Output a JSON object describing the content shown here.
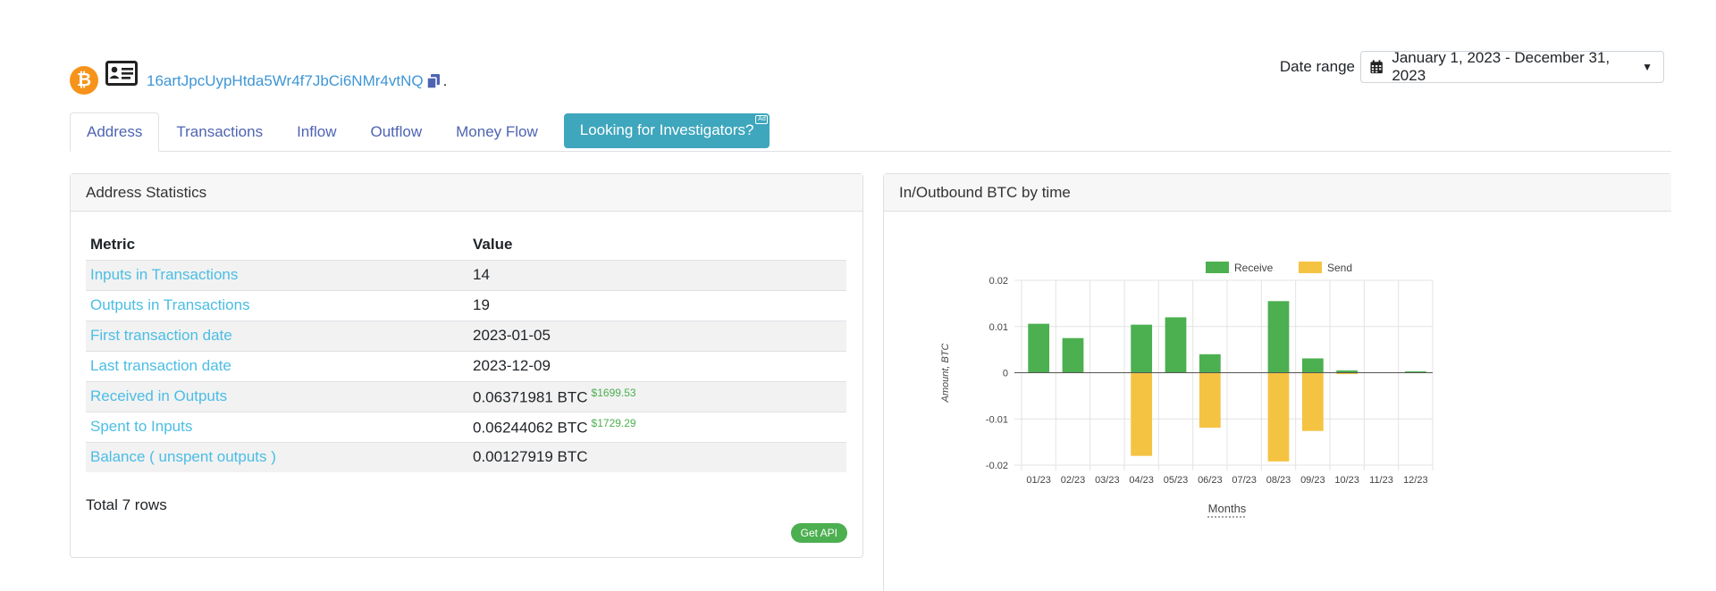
{
  "header": {
    "address": "16artJpcUypHtda5Wr4f7JbCi6NMr4vtNQ",
    "trailing": ".",
    "icons": {
      "coin": "bitcoin-icon",
      "profile": "id-card-icon",
      "copy": "copy-icon"
    },
    "date_range_label": "Date range",
    "date_range_value": "January 1, 2023 - December 31, 2023"
  },
  "tabs": [
    {
      "label": "Address",
      "active": true
    },
    {
      "label": "Transactions"
    },
    {
      "label": "Inflow"
    },
    {
      "label": "Outflow"
    },
    {
      "label": "Money Flow"
    }
  ],
  "investigators_button": {
    "label": "Looking for Investigators?",
    "badge": "Ad"
  },
  "stats": {
    "title": "Address Statistics",
    "columns": [
      "Metric",
      "Value"
    ],
    "rows": [
      {
        "metric": "Inputs in Transactions",
        "value": "14",
        "usd": ""
      },
      {
        "metric": "Outputs in Transactions",
        "value": "19",
        "usd": ""
      },
      {
        "metric": "First transaction date",
        "value": "2023-01-05",
        "usd": ""
      },
      {
        "metric": "Last transaction date",
        "value": "2023-12-09",
        "usd": ""
      },
      {
        "metric": "Received in Outputs",
        "value": "0.06371981 BTC",
        "usd": "$1699.53"
      },
      {
        "metric": "Spent to Inputs",
        "value": "0.06244062 BTC",
        "usd": "$1729.29"
      },
      {
        "metric": "Balance ( unspent outputs )",
        "value": "0.00127919 BTC",
        "usd": ""
      }
    ],
    "total": "Total 7 rows",
    "api_button": "Get API"
  },
  "chart_panel": {
    "title": "In/Outbound BTC by time"
  },
  "chart_data": {
    "type": "bar",
    "categories": [
      "01/23",
      "02/23",
      "03/23",
      "04/23",
      "05/23",
      "06/23",
      "07/23",
      "08/23",
      "09/23",
      "10/23",
      "11/23",
      "12/23"
    ],
    "series": [
      {
        "name": "Receive",
        "color": "#4caf50",
        "values": [
          0.0106,
          0.0075,
          0,
          0.0104,
          0.012,
          0.004,
          0,
          0.0155,
          0.0031,
          0.0005,
          0,
          0.0003
        ]
      },
      {
        "name": "Send",
        "color": "#f5c342",
        "values": [
          0,
          0,
          0,
          -0.018,
          0,
          -0.0119,
          0,
          -0.0192,
          -0.0126,
          -0.0003,
          0,
          0
        ]
      }
    ],
    "ylim": [
      -0.02,
      0.02
    ],
    "yticks": [
      0.02,
      0.01,
      0,
      -0.01,
      -0.02
    ],
    "ytick_labels": [
      "0.02",
      "0.01",
      "0",
      "-0.01",
      "-0.02"
    ],
    "ylabel": "Amount, BTC",
    "xlabel": "Months",
    "legend": "top",
    "grid": true
  }
}
